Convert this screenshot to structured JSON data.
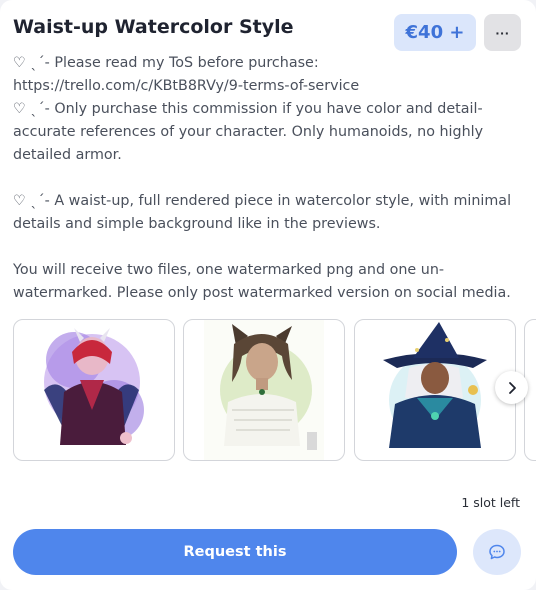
{
  "listing": {
    "title": "Waist-up Watercolor Style",
    "price_label": "€40 +",
    "more_label": "···"
  },
  "description": {
    "lines": [
      "♡ ˎˊ- Please read my ToS before purchase:",
      "https://trello.com/c/KBtB8RVy/9-terms-of-service",
      "♡ ˎˊ- Only purchase this commission if you have color and detail-",
      "accurate references of your character. Only humanoids, no highly",
      "detailed armor.",
      "",
      "♡ ˎˊ- A waist-up, full rendered piece in watercolor style, with minimal",
      "details and simple background like in the previews.",
      "",
      "You will receive two files, one watermarked png and one un-",
      "watermarked. Please only post watermarked version on social media."
    ]
  },
  "gallery": {
    "images": [
      {
        "subject": "purple-haired-character-with-horns"
      },
      {
        "subject": "cat-eared-character-in-white-blouse"
      },
      {
        "subject": "witch-hat-character-in-blue"
      }
    ],
    "icons": {
      "next": "chevron-right-icon"
    }
  },
  "footer": {
    "slots_label": "1 slot left",
    "request_label": "Request this",
    "chat_icon": "chat-bubble-icon"
  },
  "colors": {
    "accent": "#4f86ec",
    "price_bg": "#dbe6fb",
    "price_text": "#3f73d8"
  }
}
